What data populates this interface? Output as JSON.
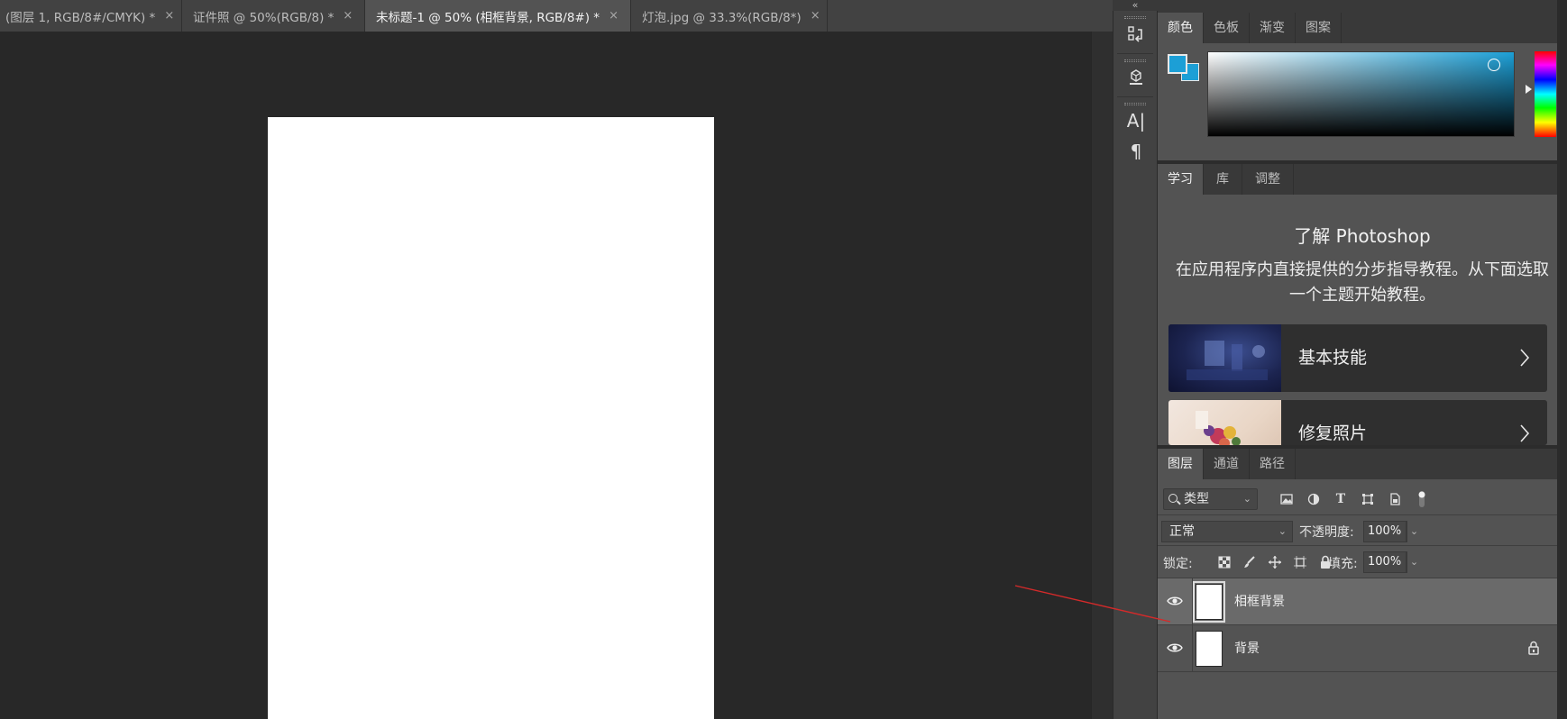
{
  "doc_tabs": [
    {
      "label": "(图层 1, RGB/8#/CMYK) *",
      "close": "×"
    },
    {
      "label": "证件照 @ 50%(RGB/8) *",
      "close": "×"
    },
    {
      "label": "未标题-1 @ 50% (相框背景, RGB/8#) *",
      "close": "×"
    },
    {
      "label": "灯泡.jpg @ 33.3%(RGB/8*)",
      "close": "×"
    }
  ],
  "active_doc_tab_index": 2,
  "dock": {
    "collapse_glyph": "«",
    "buttons": [
      {
        "icon": "history-icon"
      },
      {
        "icon": "3d-icon"
      },
      {
        "icon": "character-icon",
        "glyph": "A|"
      },
      {
        "icon": "paragraph-icon",
        "glyph": "¶"
      }
    ]
  },
  "color_panel": {
    "tabs": [
      "颜色",
      "色板",
      "渐变",
      "图案"
    ],
    "active_tab_index": 0,
    "foreground_color": "#1c9fd6",
    "background_color": "#1c9fd6"
  },
  "learn_panel": {
    "tabs": [
      "学习",
      "库",
      "调整"
    ],
    "active_tab_index": 0,
    "title": "了解 Photoshop",
    "description": "在应用程序内直接提供的分步指导教程。从下面选取一个主题开始教程。",
    "cards": [
      {
        "title": "基本技能"
      },
      {
        "title": "修复照片"
      }
    ]
  },
  "layers_panel": {
    "tabs": [
      "图层",
      "通道",
      "路径"
    ],
    "active_tab_index": 0,
    "filter_kind": "类型",
    "blend_mode": "正常",
    "opacity_label": "不透明度:",
    "opacity_value": "100%",
    "lock_label": "锁定:",
    "fill_label": "填充:",
    "fill_value": "100%",
    "layers": [
      {
        "name": "相框背景",
        "selected": true,
        "locked": false,
        "visible": true
      },
      {
        "name": "背景",
        "selected": false,
        "locked": true,
        "visible": true
      }
    ]
  },
  "colors": {
    "workspace": "#282828",
    "panel": "#535353",
    "annotation_arrow": "#d42a2a"
  }
}
